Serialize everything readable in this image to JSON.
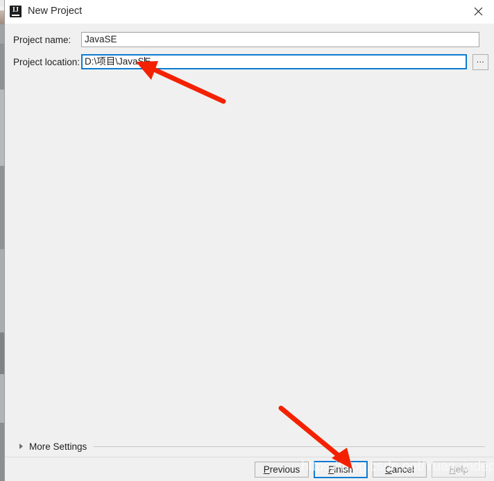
{
  "window": {
    "title": "New Project",
    "app_icon": "intellij-idea-icon",
    "close_icon": "close-icon"
  },
  "form": {
    "fields": [
      {
        "label": "Project name:",
        "value": "JavaSE",
        "placeholder": "",
        "focused": false
      },
      {
        "label": "Project location:",
        "value_before_caret": "D:\\项目\\JavaS",
        "value_after_caret": "E",
        "value": "D:\\项目\\JavaSE",
        "placeholder": "",
        "focused": true
      }
    ],
    "browse_button_label": "...",
    "more_settings_label": "More Settings",
    "more_settings_expanded": false
  },
  "buttons": {
    "previous": {
      "prefix": "",
      "mnemonic": "P",
      "suffix": "revious",
      "enabled": true,
      "default": false
    },
    "finish": {
      "prefix": "",
      "mnemonic": "F",
      "suffix": "inish",
      "enabled": true,
      "default": true
    },
    "cancel": {
      "prefix": "",
      "mnemonic": "C",
      "suffix": "ancel",
      "enabled": true,
      "default": false
    },
    "help": {
      "prefix": "",
      "mnemonic": "H",
      "suffix": "elp",
      "enabled": false,
      "default": false
    }
  },
  "watermark": {
    "text": "https://blog.csdn.net/Yuan_independent"
  },
  "annotations": {
    "arrow_to_caret": "red-arrow-pointing-to-project-location-caret",
    "arrow_to_finish": "red-arrow-pointing-to-finish-button"
  },
  "colors": {
    "accent": "#0b7bd0",
    "dialog_bg": "#f0f0f0",
    "titlebar_bg": "#ffffff",
    "annotation_red": "#f42100"
  }
}
